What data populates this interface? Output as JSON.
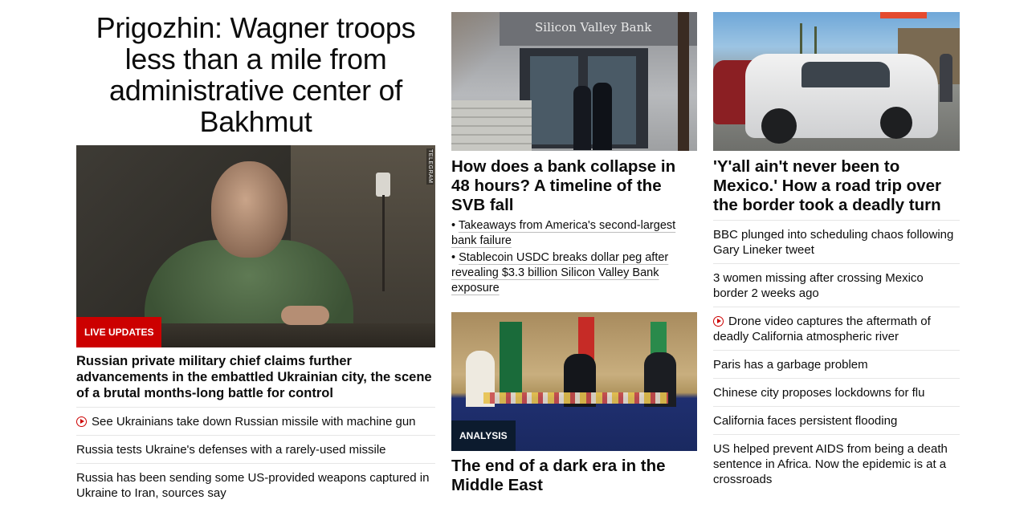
{
  "lead": {
    "headline": "Prigozhin: Wagner troops less than a mile from administrative center of Bakhmut",
    "image_credit": "TELEGRAM",
    "badge": "LIVE UPDATES",
    "subheadline": "Russian private military chief claims further advancements in the embattled Ukrainian city, the scene of a brutal months-long battle for control",
    "related": [
      {
        "text": "See Ukrainians take down Russian missile with machine gun",
        "video": true
      },
      {
        "text": "Russia tests Ukraine's defenses with a rarely-used missile",
        "video": false
      },
      {
        "text": "Russia has been sending some US-provided weapons captured in Ukraine to Iran, sources say",
        "video": false
      }
    ]
  },
  "middle": {
    "story1": {
      "image_sign": "Silicon Valley Bank",
      "headline": "How does a bank collapse in 48 hours? A timeline of the SVB fall",
      "bullets": [
        "Takeaways from America's second-largest bank failure",
        "Stablecoin USDC breaks dollar peg after revealing $3.3 billion Silicon Valley Bank exposure"
      ]
    },
    "story2": {
      "badge": "ANALYSIS",
      "headline": "The end of a dark era in the Middle East"
    }
  },
  "right": {
    "headline": "'Y'all ain't never been to Mexico.' How a road trip over the border took a deadly turn",
    "links": [
      {
        "text": "BBC plunged into scheduling chaos following Gary Lineker tweet",
        "video": false
      },
      {
        "text": "3 women missing after crossing Mexico border 2 weeks ago",
        "video": false
      },
      {
        "text": "Drone video captures the aftermath of deadly California atmospheric river",
        "video": true
      },
      {
        "text": "Paris has a garbage problem",
        "video": false
      },
      {
        "text": "Chinese city proposes lockdowns for flu",
        "video": false
      },
      {
        "text": "California faces persistent flooding",
        "video": false
      },
      {
        "text": "US helped prevent AIDS from being a death sentence in Africa. Now the epidemic is at a crossroads",
        "video": false
      }
    ]
  },
  "colors": {
    "live_badge": "#cc0000",
    "analysis_badge": "#0c1b2e",
    "play_icon": "#cc0000",
    "divider": "#e6e6e6"
  }
}
